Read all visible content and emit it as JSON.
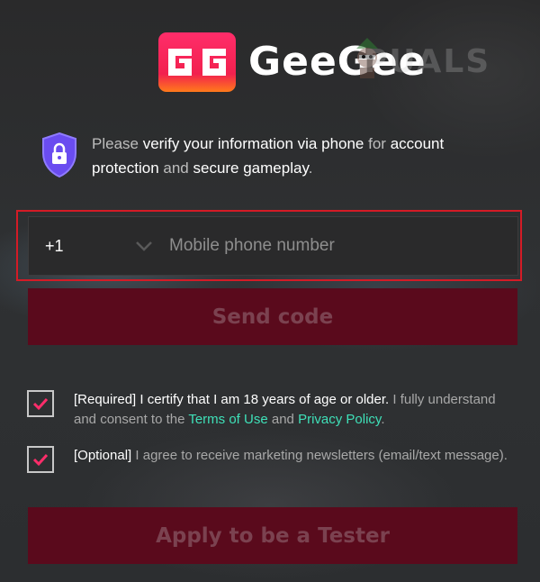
{
  "logo": {
    "badge_letters": "GG",
    "brand_name": "GeeGee",
    "watermark": "PUALS"
  },
  "info": {
    "parts": [
      {
        "text": "Please ",
        "strong": false
      },
      {
        "text": "verify your information via phone",
        "strong": true
      },
      {
        "text": " for ",
        "strong": false
      },
      {
        "text": "account protection",
        "strong": true
      },
      {
        "text": " and ",
        "strong": false
      },
      {
        "text": "secure gameplay",
        "strong": true
      },
      {
        "text": ".",
        "strong": false
      }
    ]
  },
  "phone": {
    "country_code": "+1",
    "placeholder": "Mobile phone number",
    "value": ""
  },
  "send_code_label": "Send code",
  "consents": {
    "required": {
      "checked": true,
      "prefix": "[Required] I certify that I am 18 years of age or older.",
      "middle": " I fully understand and consent to the ",
      "terms_link": "Terms of Use",
      "and": " and ",
      "privacy_link": "Privacy Policy",
      "end": "."
    },
    "optional": {
      "checked": true,
      "prefix": "[Optional]",
      "text": " I agree to receive marketing newsletters (email/text message)."
    }
  },
  "apply_label": "Apply to be a Tester",
  "colors": {
    "accent_red": "#d41b26",
    "button_dark": "#5a0a1c",
    "link": "#3fe0b8",
    "check_mark": "#ff2d6a"
  }
}
